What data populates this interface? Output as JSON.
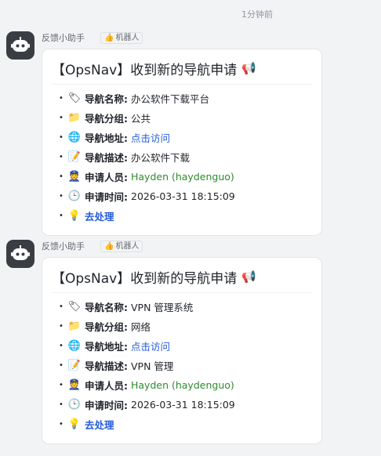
{
  "timestamp": "1分钟前",
  "messages": [
    {
      "sender": "反馈小助手",
      "tag": "机器人",
      "title": "【OpsNav】收到新的导航申请",
      "title_icon": "megaphone-icon",
      "fields": {
        "name_label": "导航名称:",
        "name_value": "办公软件下载平台",
        "group_label": "导航分组:",
        "group_value": "公共",
        "url_label": "导航地址:",
        "url_value": "点击访问",
        "desc_label": "导航描述:",
        "desc_value": "办公软件下载",
        "applicant_label": "申请人员:",
        "applicant_value": "Hayden (haydenguo)",
        "time_label": "申请时间:",
        "time_value": "2026-03-31 18:15:09",
        "action_label": "去处理"
      }
    },
    {
      "sender": "反馈小助手",
      "tag": "机器人",
      "title": "【OpsNav】收到新的导航申请",
      "title_icon": "megaphone-icon",
      "fields": {
        "name_label": "导航名称:",
        "name_value": "VPN 管理系统",
        "group_label": "导航分组:",
        "group_value": "网络",
        "url_label": "导航地址:",
        "url_value": "点击访问",
        "desc_label": "导航描述:",
        "desc_value": "VPN 管理",
        "applicant_label": "申请人员:",
        "applicant_value": "Hayden (haydenguo)",
        "time_label": "申请时间:",
        "time_value": "2026-03-31 18:15:09",
        "action_label": "去处理"
      }
    }
  ],
  "colors": {
    "link": "#245bdb",
    "applicant": "#2e8a2e",
    "avatar_bg": "#3a3d44"
  }
}
